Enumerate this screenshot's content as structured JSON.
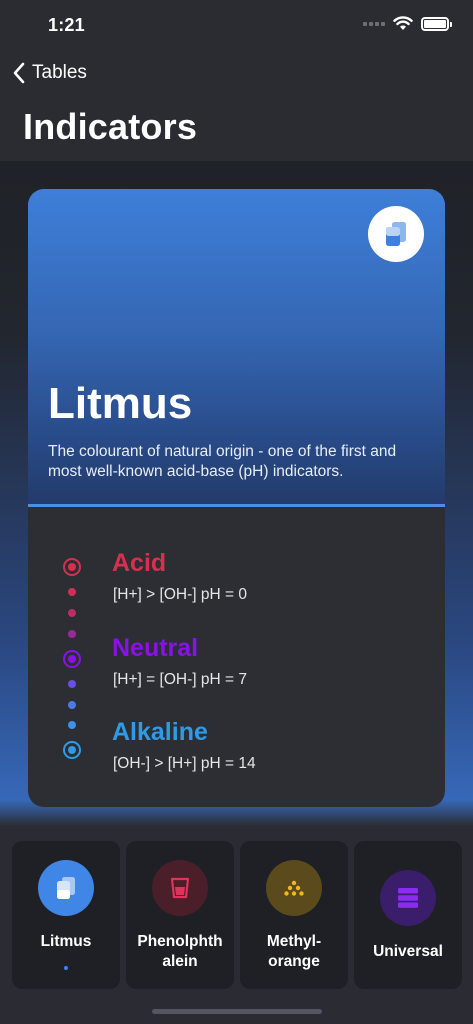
{
  "status_bar": {
    "time": "1:21"
  },
  "nav": {
    "back_label": "Tables",
    "title": "Indicators"
  },
  "card": {
    "title": "Litmus",
    "description": "The colourant of natural origin - one of the first and most well-known acid-base (pH) indicators.",
    "levels": [
      {
        "name": "Acid",
        "formula": "[H+] > [OH-] pH = 0",
        "color": "#d7304f"
      },
      {
        "name": "Neutral",
        "formula": "[H+] = [OH-] pH = 7",
        "color": "#8a12e6"
      },
      {
        "name": "Alkaline",
        "formula": "[OH-] > [H+] pH = 14",
        "color": "#2d9be6"
      }
    ]
  },
  "tabs": [
    {
      "label": "Litmus",
      "icon": "litmus-icon",
      "color": "#3f86e6",
      "selected": true
    },
    {
      "label": "Phenolphthalein",
      "label_lines": [
        "Phenolphth",
        "alein"
      ],
      "icon": "beaker-icon",
      "color": "#4b1f2a"
    },
    {
      "label": "Methyl-orange",
      "label_lines": [
        "Methyl-",
        "orange"
      ],
      "icon": "dots-icon",
      "color": "#5a4a1c"
    },
    {
      "label": "Universal",
      "icon": "stack-icon",
      "color": "#3a1d6b"
    }
  ]
}
